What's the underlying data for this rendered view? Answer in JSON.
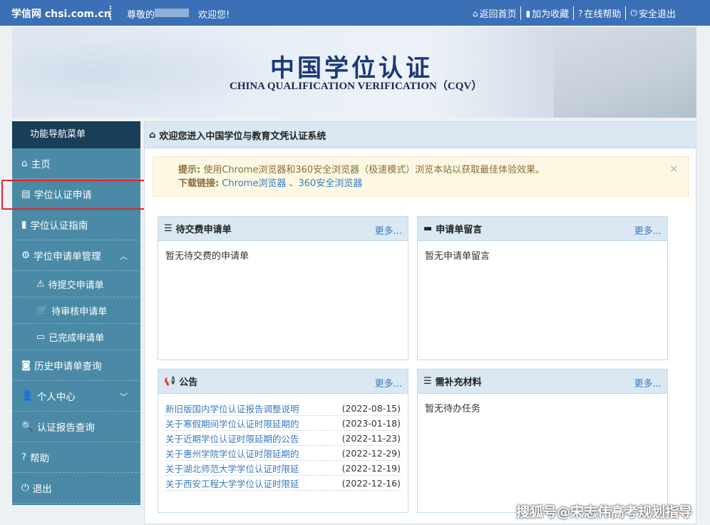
{
  "topbar": {
    "brand": "学信网 chsi.com.cn",
    "greeting": "尊敬的",
    "welcome": "欢迎您!",
    "links": [
      {
        "icon": "home-icon",
        "glyph": "⌂",
        "label": "返回首页"
      },
      {
        "icon": "bookmark-icon",
        "glyph": "▮",
        "label": "加为收藏"
      },
      {
        "icon": "question-icon",
        "glyph": "?",
        "label": "在线帮助"
      },
      {
        "icon": "power-icon",
        "glyph": "⏻",
        "label": "安全退出"
      }
    ]
  },
  "banner": {
    "title": "中国学位认证",
    "subtitle": "CHINA QUALIFICATION VERIFICATION（CQV）"
  },
  "sidebar": {
    "header": "功能导航菜单",
    "items": [
      {
        "label": "主页",
        "glyph": "⌂"
      },
      {
        "label": "学位认证申请",
        "glyph": "▤"
      },
      {
        "label": "学位认证指南",
        "glyph": "▮"
      },
      {
        "label": "学位申请单管理",
        "glyph": "⚙",
        "chevron": "︿"
      },
      {
        "label": "待提交申请单",
        "glyph": "⚠"
      },
      {
        "label": "待审核申请单",
        "glyph": "🛒"
      },
      {
        "label": "已完成申请单",
        "glyph": "▭"
      },
      {
        "label": "历史申请单查询",
        "glyph": "◙"
      },
      {
        "label": "个人中心",
        "glyph": "👤",
        "chevron": "﹀"
      },
      {
        "label": "认证报告查询",
        "glyph": "🔍"
      },
      {
        "label": "帮助",
        "glyph": "?"
      },
      {
        "label": "退出",
        "glyph": "⏻"
      }
    ]
  },
  "main": {
    "header": "欢迎您进入中国学位与教育文凭认证系统",
    "notice": {
      "tip_label": "提示:",
      "tip_text": "使用Chrome浏览器和360安全浏览器（极速模式）浏览本站以获取最佳体验效果。",
      "download_label": "下载链接:",
      "link1": "Chrome浏览器",
      "sep": "、",
      "link2": "360安全浏览器",
      "close": "×"
    },
    "panels": {
      "pending_payment": {
        "title": "待交费申请单",
        "more": "更多...",
        "empty": "暂无待交费的申请单"
      },
      "messages": {
        "title": "申请单留言",
        "more": "更多...",
        "empty": "暂无申请单留言"
      },
      "announcements": {
        "title": "公告",
        "more": "更多...",
        "items": [
          {
            "title": "新旧版国内学位认证报告调整说明",
            "date": "(2022-08-15)"
          },
          {
            "title": "关于寒假期间学位认证时限延期的",
            "date": "(2023-01-18)"
          },
          {
            "title": "关于近期学位认证时限延期的公告",
            "date": "(2022-11-23)"
          },
          {
            "title": "关于惠州学院学位认证时限延期的",
            "date": "(2022-12-29)"
          },
          {
            "title": "关于湖北师范大学学位认证时限延",
            "date": "(2022-12-19)"
          },
          {
            "title": "关于西安工程大学学位认证时限延",
            "date": "(2022-12-16)"
          }
        ]
      },
      "supplement": {
        "title": "需补充材料",
        "more": "更多...",
        "empty": "暂无待办任务"
      }
    }
  },
  "watermark": "搜狐号@宋志伟高考规划指导",
  "colors": {
    "topbar": "#3b6fb6",
    "sidebar": "#4a8aa6",
    "sidebar_head": "#183e58",
    "link": "#3a7bbf",
    "highlight": "#e0262b"
  }
}
